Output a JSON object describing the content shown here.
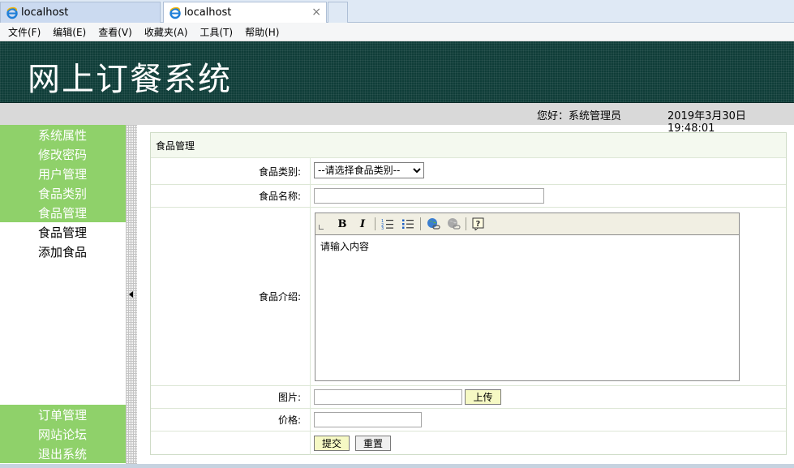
{
  "browser": {
    "tabs": [
      {
        "label": "localhost"
      },
      {
        "label": "localhost"
      }
    ],
    "close_glyph": "×",
    "menu": [
      "文件(F)",
      "编辑(E)",
      "查看(V)",
      "收藏夹(A)",
      "工具(T)",
      "帮助(H)"
    ]
  },
  "header": {
    "title": "网上订餐系统",
    "greeting": "您好：系统管理员",
    "datetime": "2019年3月30日 19:48:01"
  },
  "sidebar": {
    "top_groups": [
      "系统属性",
      "修改密码",
      "用户管理",
      "食品类别",
      "食品管理"
    ],
    "sub_items": [
      "食品管理",
      "添加食品"
    ],
    "bottom_groups": [
      "订单管理",
      "网站论坛",
      "退出系统"
    ]
  },
  "form": {
    "caption": "食品管理",
    "category_label": "食品类别:",
    "category_selected": "--请选择食品类别--",
    "name_label": "食品名称:",
    "name_value": "",
    "intro_label": "食品介绍:",
    "intro_placeholder": "请输入内容",
    "image_label": "图片:",
    "image_value": "",
    "upload_button": "上传",
    "price_label": "价格:",
    "price_value": "",
    "submit_button": "提交",
    "reset_button": "重置"
  },
  "editor_toolbar": {
    "bold": "B",
    "italic": "I",
    "icons": [
      "ordered-list-icon",
      "unordered-list-icon",
      "insert-link-icon",
      "remove-link-icon",
      "help-icon"
    ]
  },
  "colors": {
    "header_bg": "#0f3d38",
    "sidebar_green": "#8fd16a",
    "status_gray": "#d9d9d9",
    "button_yellow": "#f6f9c4"
  }
}
